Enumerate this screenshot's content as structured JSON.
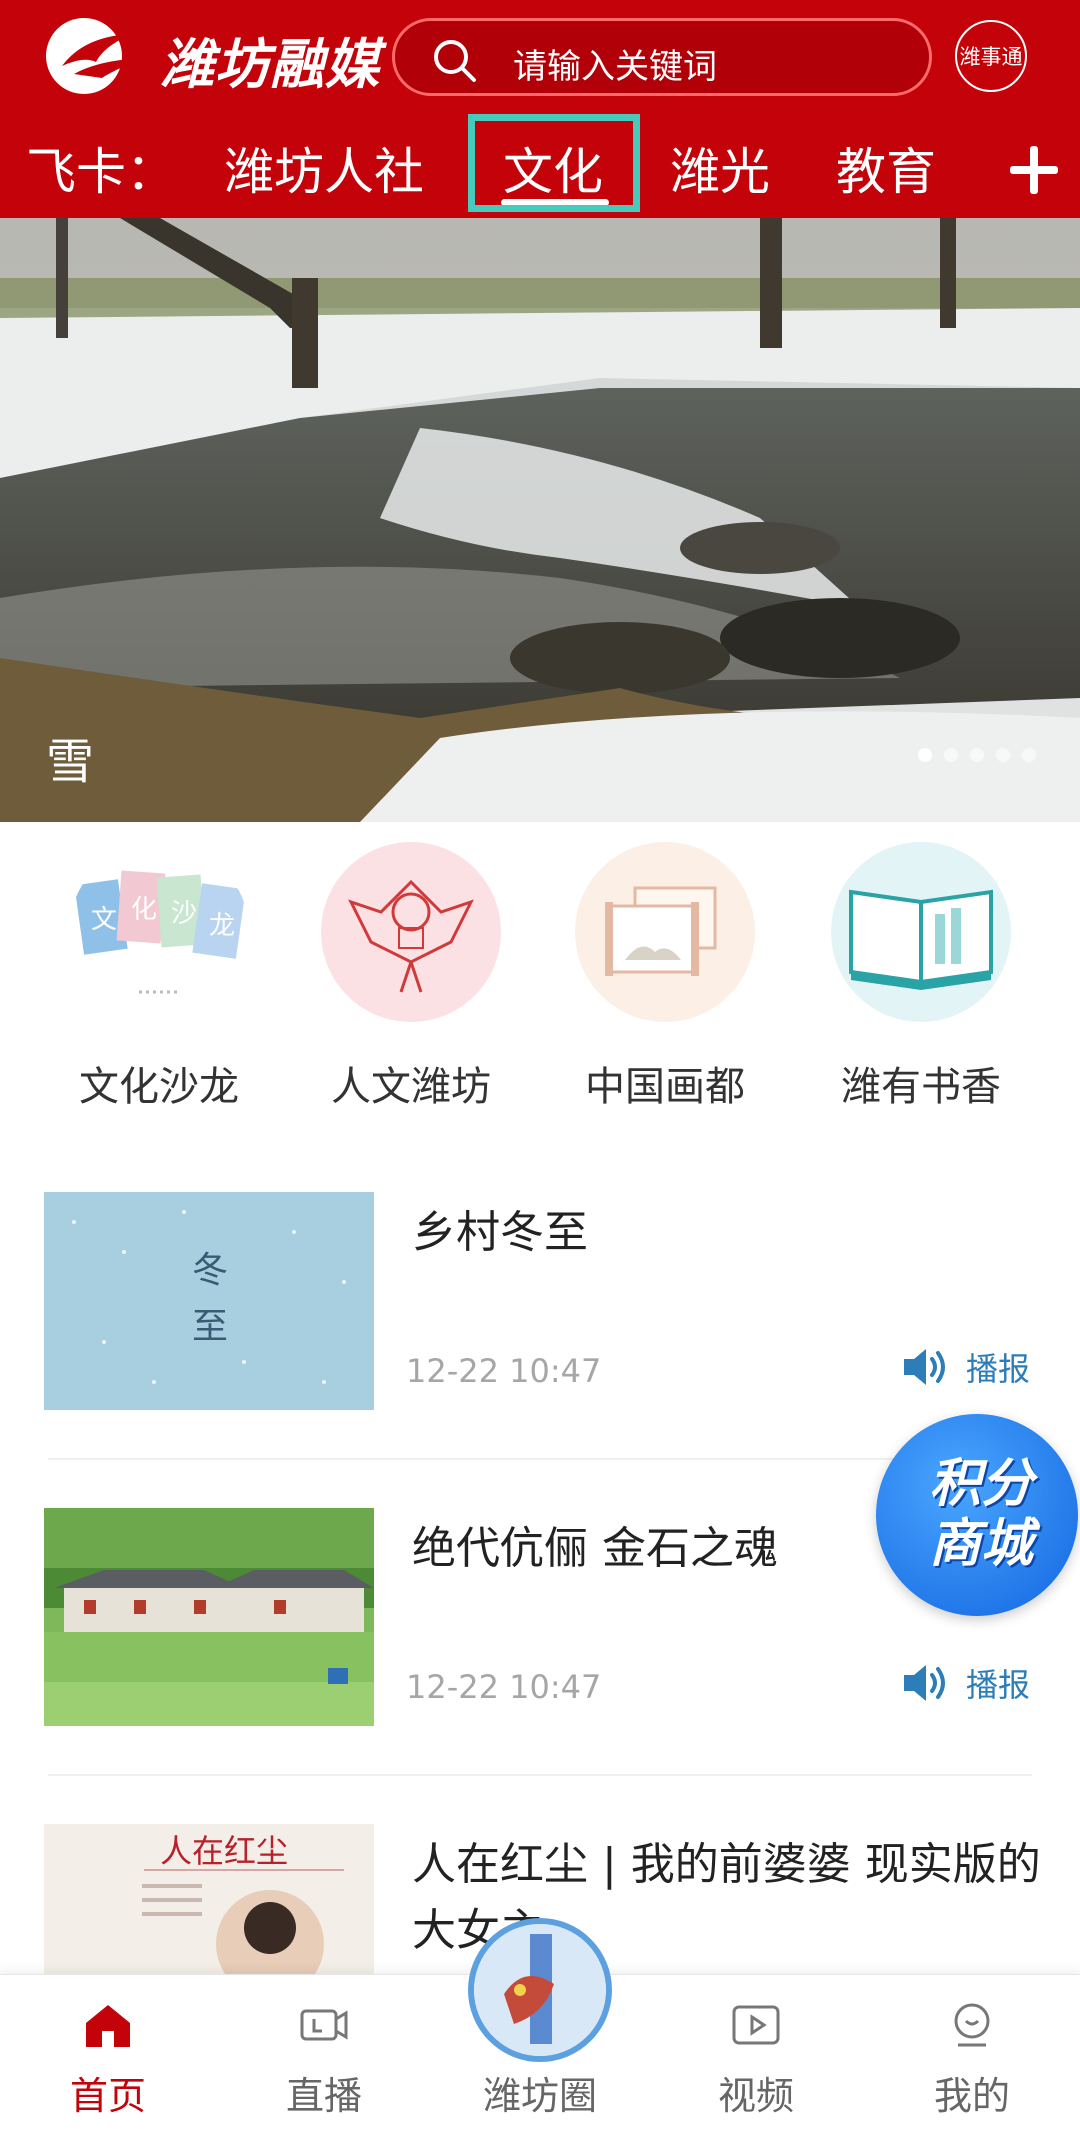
{
  "header": {
    "brand": "潍坊融媒",
    "search_placeholder": "请输入关键词",
    "wst_label": "潍事通"
  },
  "tabs": [
    {
      "label": "飞卡："
    },
    {
      "label": "潍坊人社"
    },
    {
      "label": "文化"
    },
    {
      "label": "潍光"
    },
    {
      "label": "教育"
    }
  ],
  "banner": {
    "caption": "雪",
    "slide_count": 5,
    "active_slide": 1
  },
  "categories": [
    {
      "label": "文化沙龙",
      "icon": "culture-salon-icon"
    },
    {
      "label": "人文潍坊",
      "icon": "kite-icon"
    },
    {
      "label": "中国画都",
      "icon": "scroll-painting-icon"
    },
    {
      "label": "潍有书香",
      "icon": "book-icon"
    }
  ],
  "category_art": {
    "salon_chars": [
      "文",
      "化",
      "沙",
      "龙"
    ],
    "dongzhi": [
      "冬",
      "至"
    ],
    "renzai_title": "人在红尘"
  },
  "news": [
    {
      "title": "乡村冬至",
      "time": "12-22 10:47",
      "action": "播报"
    },
    {
      "title": "绝代伉俪 金石之魂",
      "time": "12-22 10:47",
      "action": "播报"
    },
    {
      "title": "人在红尘 | 我的前婆婆 现实版的大女主",
      "time": "",
      "action": ""
    }
  ],
  "floating": {
    "line1": "积分",
    "line2": "商城"
  },
  "bottom_nav": [
    {
      "label": "首页",
      "icon": "home-icon",
      "active": true
    },
    {
      "label": "直播",
      "icon": "live-camera-icon",
      "active": false
    },
    {
      "label": "潍坊圈",
      "icon": "weifang-circle-icon",
      "active": false
    },
    {
      "label": "视频",
      "icon": "video-play-icon",
      "active": false
    },
    {
      "label": "我的",
      "icon": "profile-icon",
      "active": false
    }
  ],
  "colors": {
    "brand_red": "#c4020a",
    "highlight_teal": "#47c9bc",
    "link_blue": "#2d7eb8",
    "active_tab": "#c4020a"
  }
}
